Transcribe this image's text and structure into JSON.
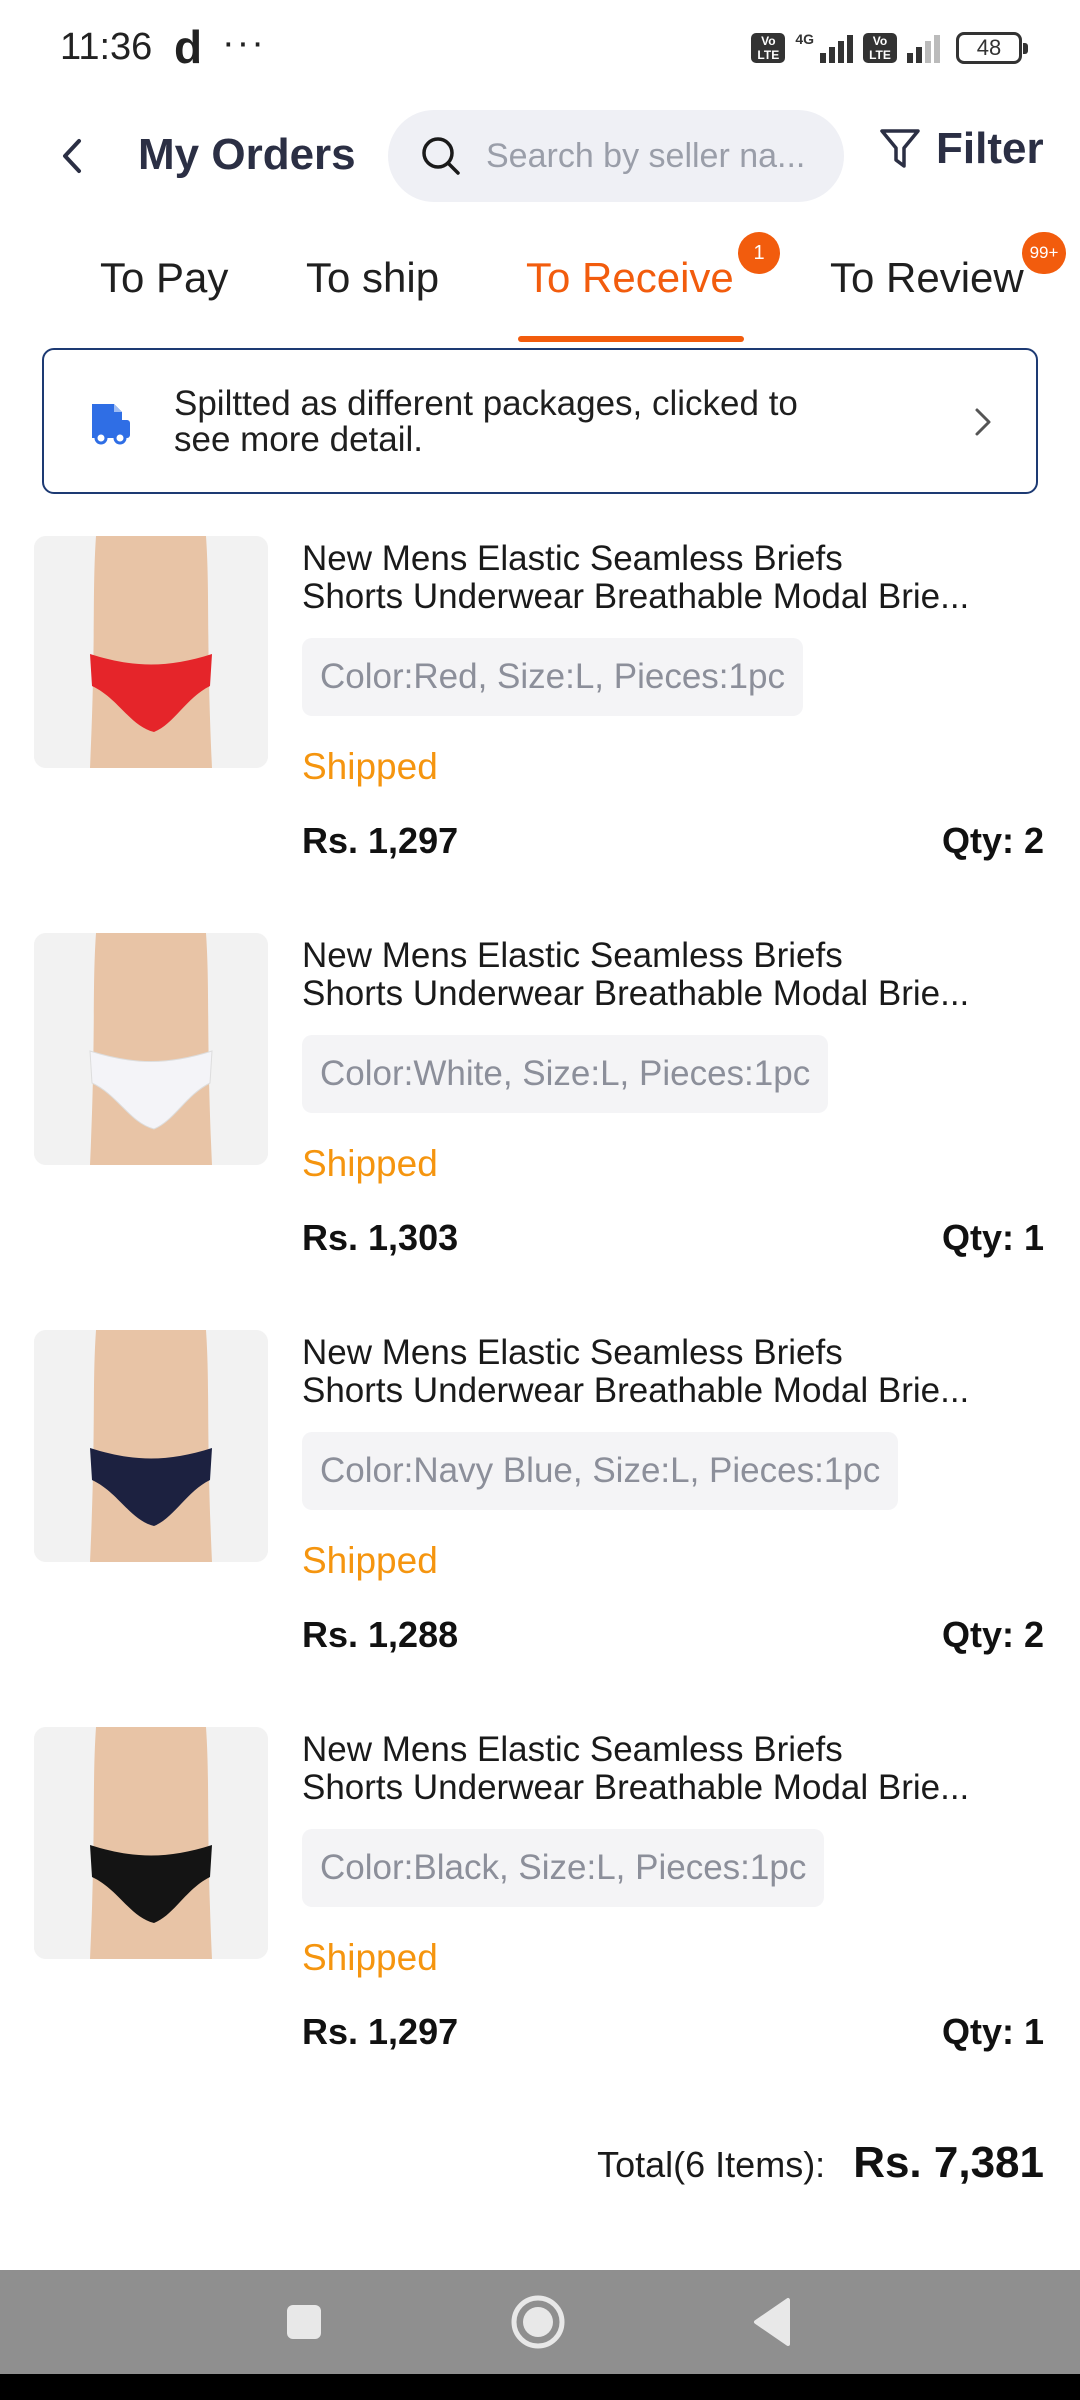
{
  "status_bar": {
    "time": "11:36",
    "carrier_glyph": "d",
    "more": "···",
    "network_label": "4G",
    "volte_label": "Vo LTE",
    "battery": "48"
  },
  "header": {
    "title": "My Orders",
    "search_placeholder": "Search by seller na...",
    "filter_label": "Filter"
  },
  "tabs": [
    {
      "label": "To Pay",
      "active": false,
      "badge": ""
    },
    {
      "label": "To ship",
      "active": false,
      "badge": ""
    },
    {
      "label": "To Receive",
      "active": true,
      "badge": "1"
    },
    {
      "label": "To Review",
      "active": false,
      "badge": "99+"
    }
  ],
  "notice": {
    "line1": "Spiltted as different packages, clicked to",
    "line2": "see more detail.",
    "icon": "truck-icon"
  },
  "orders": [
    {
      "title_line1": "New Mens Elastic Seamless Briefs",
      "title_line2": "Shorts Underwear Breathable Modal Brie...",
      "variant": "Color:Red, Size:L, Pieces:1pc",
      "status": "Shipped",
      "price": "Rs. 1,297",
      "qty": "Qty: 2",
      "swatch": "#e5252a"
    },
    {
      "title_line1": "New Mens Elastic Seamless Briefs",
      "title_line2": "Shorts Underwear Breathable Modal Brie...",
      "variant": "Color:White, Size:L, Pieces:1pc",
      "status": "Shipped",
      "price": "Rs. 1,303",
      "qty": "Qty: 1",
      "swatch": "#f4f4f8"
    },
    {
      "title_line1": "New Mens Elastic Seamless Briefs",
      "title_line2": "Shorts Underwear Breathable Modal Brie...",
      "variant": "Color:Navy Blue, Size:L, Pieces:1pc",
      "status": "Shipped",
      "price": "Rs. 1,288",
      "qty": "Qty: 2",
      "swatch": "#1c2140"
    },
    {
      "title_line1": "New Mens Elastic Seamless Briefs",
      "title_line2": "Shorts Underwear Breathable Modal Brie...",
      "variant": "Color:Black, Size:L, Pieces:1pc",
      "status": "Shipped",
      "price": "Rs. 1,297",
      "qty": "Qty: 1",
      "swatch": "#141414"
    }
  ],
  "total": {
    "label": "Total(6 Items):",
    "value": "Rs. 7,381"
  },
  "colors": {
    "accent": "#f25c0d",
    "shipped": "#f5950f",
    "notice_border": "#1d3a73",
    "truck": "#2f6ee5"
  }
}
